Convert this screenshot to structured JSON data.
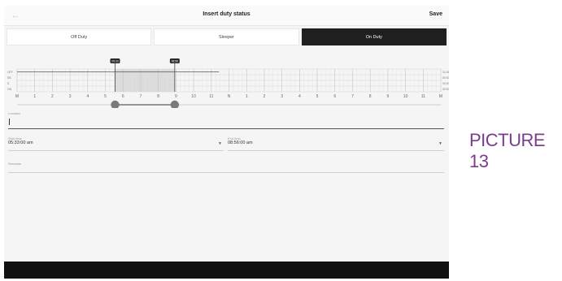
{
  "header": {
    "title": "Insert duty status",
    "save_label": "Save",
    "back_icon": "arrow-left-icon"
  },
  "tabs": [
    {
      "label": "Off Duty",
      "active": false
    },
    {
      "label": "Sleeper",
      "active": false
    },
    {
      "label": "On Duty",
      "active": true
    }
  ],
  "chart_data": {
    "type": "gantt",
    "rows": [
      "OFF",
      "SB",
      "D",
      "ON"
    ],
    "hour_labels": [
      "M",
      "1",
      "2",
      "3",
      "4",
      "5",
      "6",
      "7",
      "8",
      "9",
      "10",
      "11",
      "N",
      "1",
      "2",
      "3",
      "4",
      "5",
      "6",
      "7",
      "8",
      "9",
      "10",
      "11",
      "M"
    ],
    "row_totals": [
      "11:26",
      "00:00",
      "00:00",
      "00:00"
    ],
    "selection": {
      "start_label": "05:33",
      "end_label": "08:56",
      "start_hour": 5.55,
      "end_hour": 8.93
    },
    "line": {
      "row": "OFF",
      "start_hour": 0,
      "end_hour": 11.43
    }
  },
  "form": {
    "location": {
      "label": "Location",
      "value": ""
    },
    "start_time": {
      "label": "Start time",
      "value": "05:33:00 am"
    },
    "end_time": {
      "label": "End time",
      "value": "08:56:00 am"
    },
    "remarks": {
      "label": "Remarks",
      "value": ""
    }
  },
  "caption": "PICTURE 13",
  "colors": {
    "active_tab": "#1f1f1f",
    "caption": "#7b3b8e",
    "selection": "#dcdcdc"
  }
}
